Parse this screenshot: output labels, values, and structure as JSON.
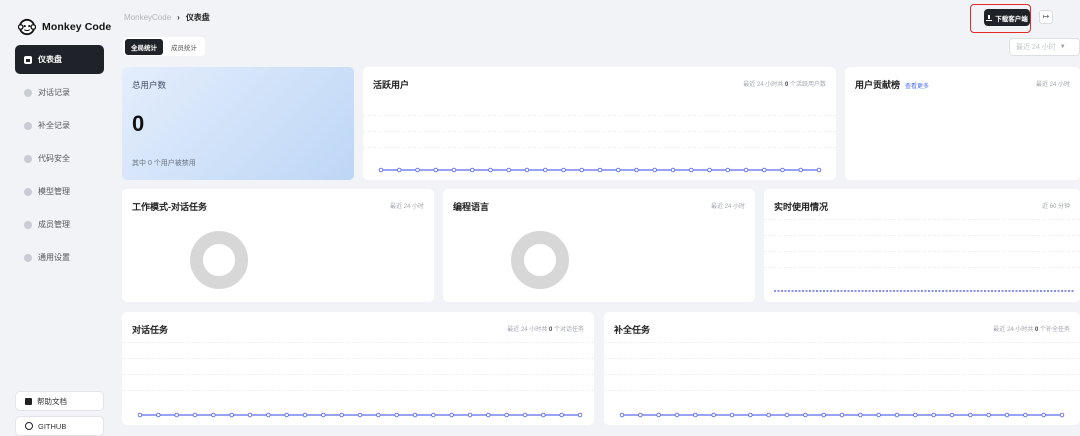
{
  "app": {
    "name": "Monkey Code"
  },
  "sidebar": {
    "items": [
      {
        "label": "仪表盘",
        "active": true
      },
      {
        "label": "对话记录",
        "active": false
      },
      {
        "label": "补全记录",
        "active": false
      },
      {
        "label": "代码安全",
        "active": false
      },
      {
        "label": "模型管理",
        "active": false
      },
      {
        "label": "成员管理",
        "active": false
      },
      {
        "label": "通用设置",
        "active": false
      }
    ],
    "help_label": "帮助文档",
    "github_label": "GITHUB"
  },
  "breadcrumb": {
    "root": "MonkeyCode",
    "sep": "›",
    "current": "仪表盘"
  },
  "tabs": [
    {
      "label": "全局统计",
      "active": true
    },
    {
      "label": "成员统计",
      "active": false
    }
  ],
  "header": {
    "download_label": "下载客户端",
    "logout_icon": "logout-icon"
  },
  "range_select": {
    "value": "最近 24 小时"
  },
  "cards": {
    "total_users": {
      "label": "总用户数",
      "value": "0",
      "footer": "其中 0 个用户被禁用"
    },
    "active_users": {
      "title": "活跃用户",
      "meta_pre": "最近 24 小时共",
      "meta_num": "0",
      "meta_post": "个活跃用户数"
    },
    "contribution": {
      "title": "用户贡献榜",
      "more": "查看更多",
      "meta": "最近 24 小时"
    },
    "work_mode": {
      "title": "工作模式-对话任务",
      "meta": "最近 24 小时"
    },
    "languages": {
      "title": "编程语言",
      "meta": "最近 24 小时"
    },
    "realtime": {
      "title": "实时使用情况",
      "meta": "近 60 分钟"
    },
    "chat_tasks": {
      "title": "对话任务",
      "meta_pre": "最近 24 小时共",
      "meta_num": "0",
      "meta_post": "个对话任务"
    },
    "completion_tasks": {
      "title": "补全任务",
      "meta_pre": "最近 24 小时共",
      "meta_num": "0",
      "meta_post": "个补全任务"
    }
  },
  "chart_data": [
    {
      "type": "line",
      "name": "active_users",
      "values": [
        0,
        0,
        0,
        0,
        0,
        0,
        0,
        0,
        0,
        0,
        0,
        0,
        0,
        0,
        0,
        0,
        0,
        0,
        0,
        0,
        0,
        0,
        0,
        0,
        0
      ]
    },
    {
      "type": "line",
      "name": "realtime",
      "values": [
        0,
        0,
        0,
        0,
        0,
        0,
        0,
        0,
        0,
        0,
        0,
        0,
        0,
        0,
        0,
        0,
        0,
        0,
        0,
        0,
        0,
        0,
        0,
        0,
        0,
        0,
        0,
        0,
        0,
        0,
        0,
        0,
        0,
        0,
        0,
        0,
        0,
        0,
        0,
        0,
        0,
        0,
        0,
        0,
        0,
        0,
        0,
        0,
        0,
        0,
        0,
        0,
        0,
        0,
        0,
        0,
        0,
        0,
        0,
        0
      ]
    },
    {
      "type": "line",
      "name": "chat_tasks",
      "values": [
        0,
        0,
        0,
        0,
        0,
        0,
        0,
        0,
        0,
        0,
        0,
        0,
        0,
        0,
        0,
        0,
        0,
        0,
        0,
        0,
        0,
        0,
        0,
        0,
        0
      ]
    },
    {
      "type": "line",
      "name": "completion_tasks",
      "values": [
        0,
        0,
        0,
        0,
        0,
        0,
        0,
        0,
        0,
        0,
        0,
        0,
        0,
        0,
        0,
        0,
        0,
        0,
        0,
        0,
        0,
        0,
        0,
        0,
        0
      ]
    }
  ],
  "colors": {
    "line": "#5b6cf2",
    "donut": "#d7d7d7",
    "accent": "#1f2329",
    "highlight": "#e12a2a"
  }
}
